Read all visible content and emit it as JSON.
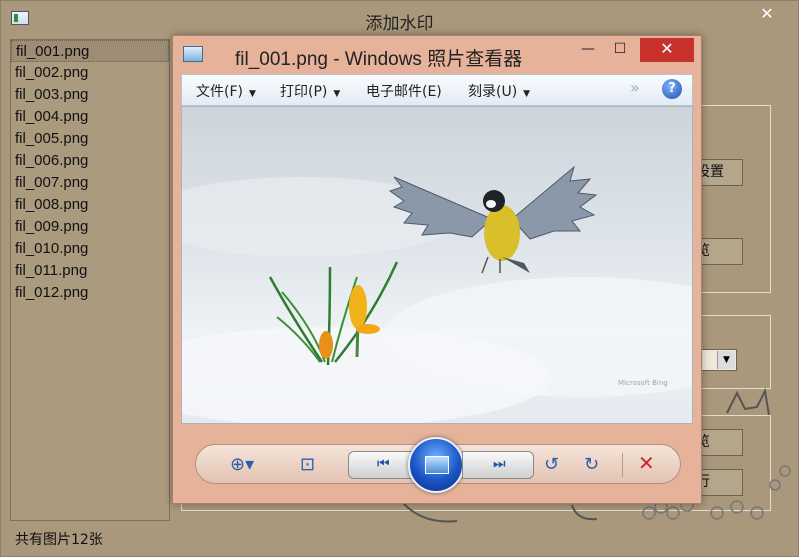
{
  "host": {
    "title": "添加水印",
    "close_glyph": "✕",
    "files": [
      "fil_001.png",
      "fil_002.png",
      "fil_003.png",
      "fil_004.png",
      "fil_005.png",
      "fil_006.png",
      "fil_007.png",
      "fil_008.png",
      "fil_009.png",
      "fil_010.png",
      "fil_011.png",
      "fil_012.png"
    ],
    "selected_file": "fil_001.png",
    "status": "共有图片12张",
    "btn_settings": "设置",
    "btn_preview1": "览",
    "btn_preview2": "览",
    "btn_exec": "行"
  },
  "viewer": {
    "title": "fil_001.png - Windows 照片查看器",
    "min_glyph": "—",
    "max_glyph": "☐",
    "close_glyph": "✕",
    "menu": {
      "file": "文件(F)",
      "print": "打印(P)",
      "mail": "电子邮件(E)",
      "burn": "刻录(U)",
      "more": "»",
      "help": "?"
    },
    "toolbar": {
      "zoom_icon": "zoom-icon",
      "fit_icon": "actual-size-icon",
      "prev_icon": "previous-icon",
      "slideshow_icon": "slideshow-icon",
      "next_icon": "next-icon",
      "rotate_left_icon": "rotate-left-icon",
      "rotate_right_icon": "rotate-right-icon",
      "delete_icon": "delete-icon"
    },
    "photo_watermark": "Microsoft Bing"
  },
  "colors": {
    "viewer_frame": "#e6b39a",
    "host_bg": "#a9987c",
    "close_red": "#c7322c",
    "accent_blue": "#1b54c5"
  }
}
